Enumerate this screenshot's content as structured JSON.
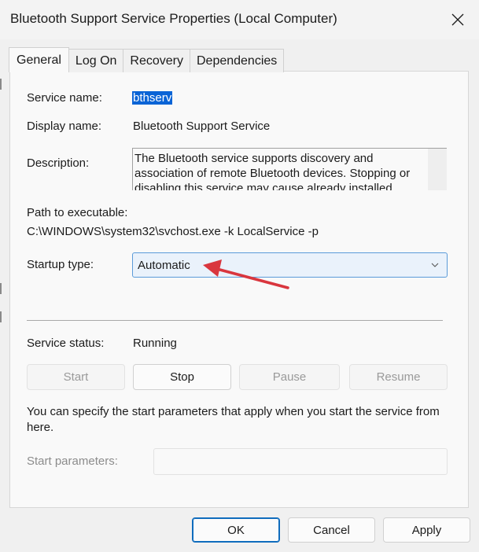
{
  "window": {
    "title": "Bluetooth Support Service Properties (Local Computer)"
  },
  "tabs": [
    {
      "label": "General",
      "active": true
    },
    {
      "label": "Log On",
      "active": false
    },
    {
      "label": "Recovery",
      "active": false
    },
    {
      "label": "Dependencies",
      "active": false
    }
  ],
  "general": {
    "service_name_label": "Service name:",
    "service_name_value": "bthserv",
    "display_name_label": "Display name:",
    "display_name_value": "Bluetooth Support Service",
    "description_label": "Description:",
    "description_value": "The Bluetooth service supports discovery and association of remote Bluetooth devices.  Stopping or disabling this service may cause already installed",
    "path_label": "Path to executable:",
    "path_value": "C:\\WINDOWS\\system32\\svchost.exe -k LocalService -p",
    "startup_type_label": "Startup type:",
    "startup_type_value": "Automatic",
    "service_status_label": "Service status:",
    "service_status_value": "Running",
    "buttons": {
      "start": "Start",
      "stop": "Stop",
      "pause": "Pause",
      "resume": "Resume"
    },
    "start_params_help": "You can specify the start parameters that apply when you start the service from here.",
    "start_params_label": "Start parameters:",
    "start_params_value": ""
  },
  "footer": {
    "ok": "OK",
    "cancel": "Cancel",
    "apply": "Apply"
  },
  "colors": {
    "selection": "#0a64d6",
    "combo_background": "#eaf2fb",
    "combo_border": "#5b9bd9",
    "annotation_arrow": "#d9363e",
    "primary_border": "#0f6cbd"
  },
  "icons": {
    "close": "close-icon",
    "dropdown": "chevron-down-icon",
    "annotation": "annotation-arrow"
  }
}
